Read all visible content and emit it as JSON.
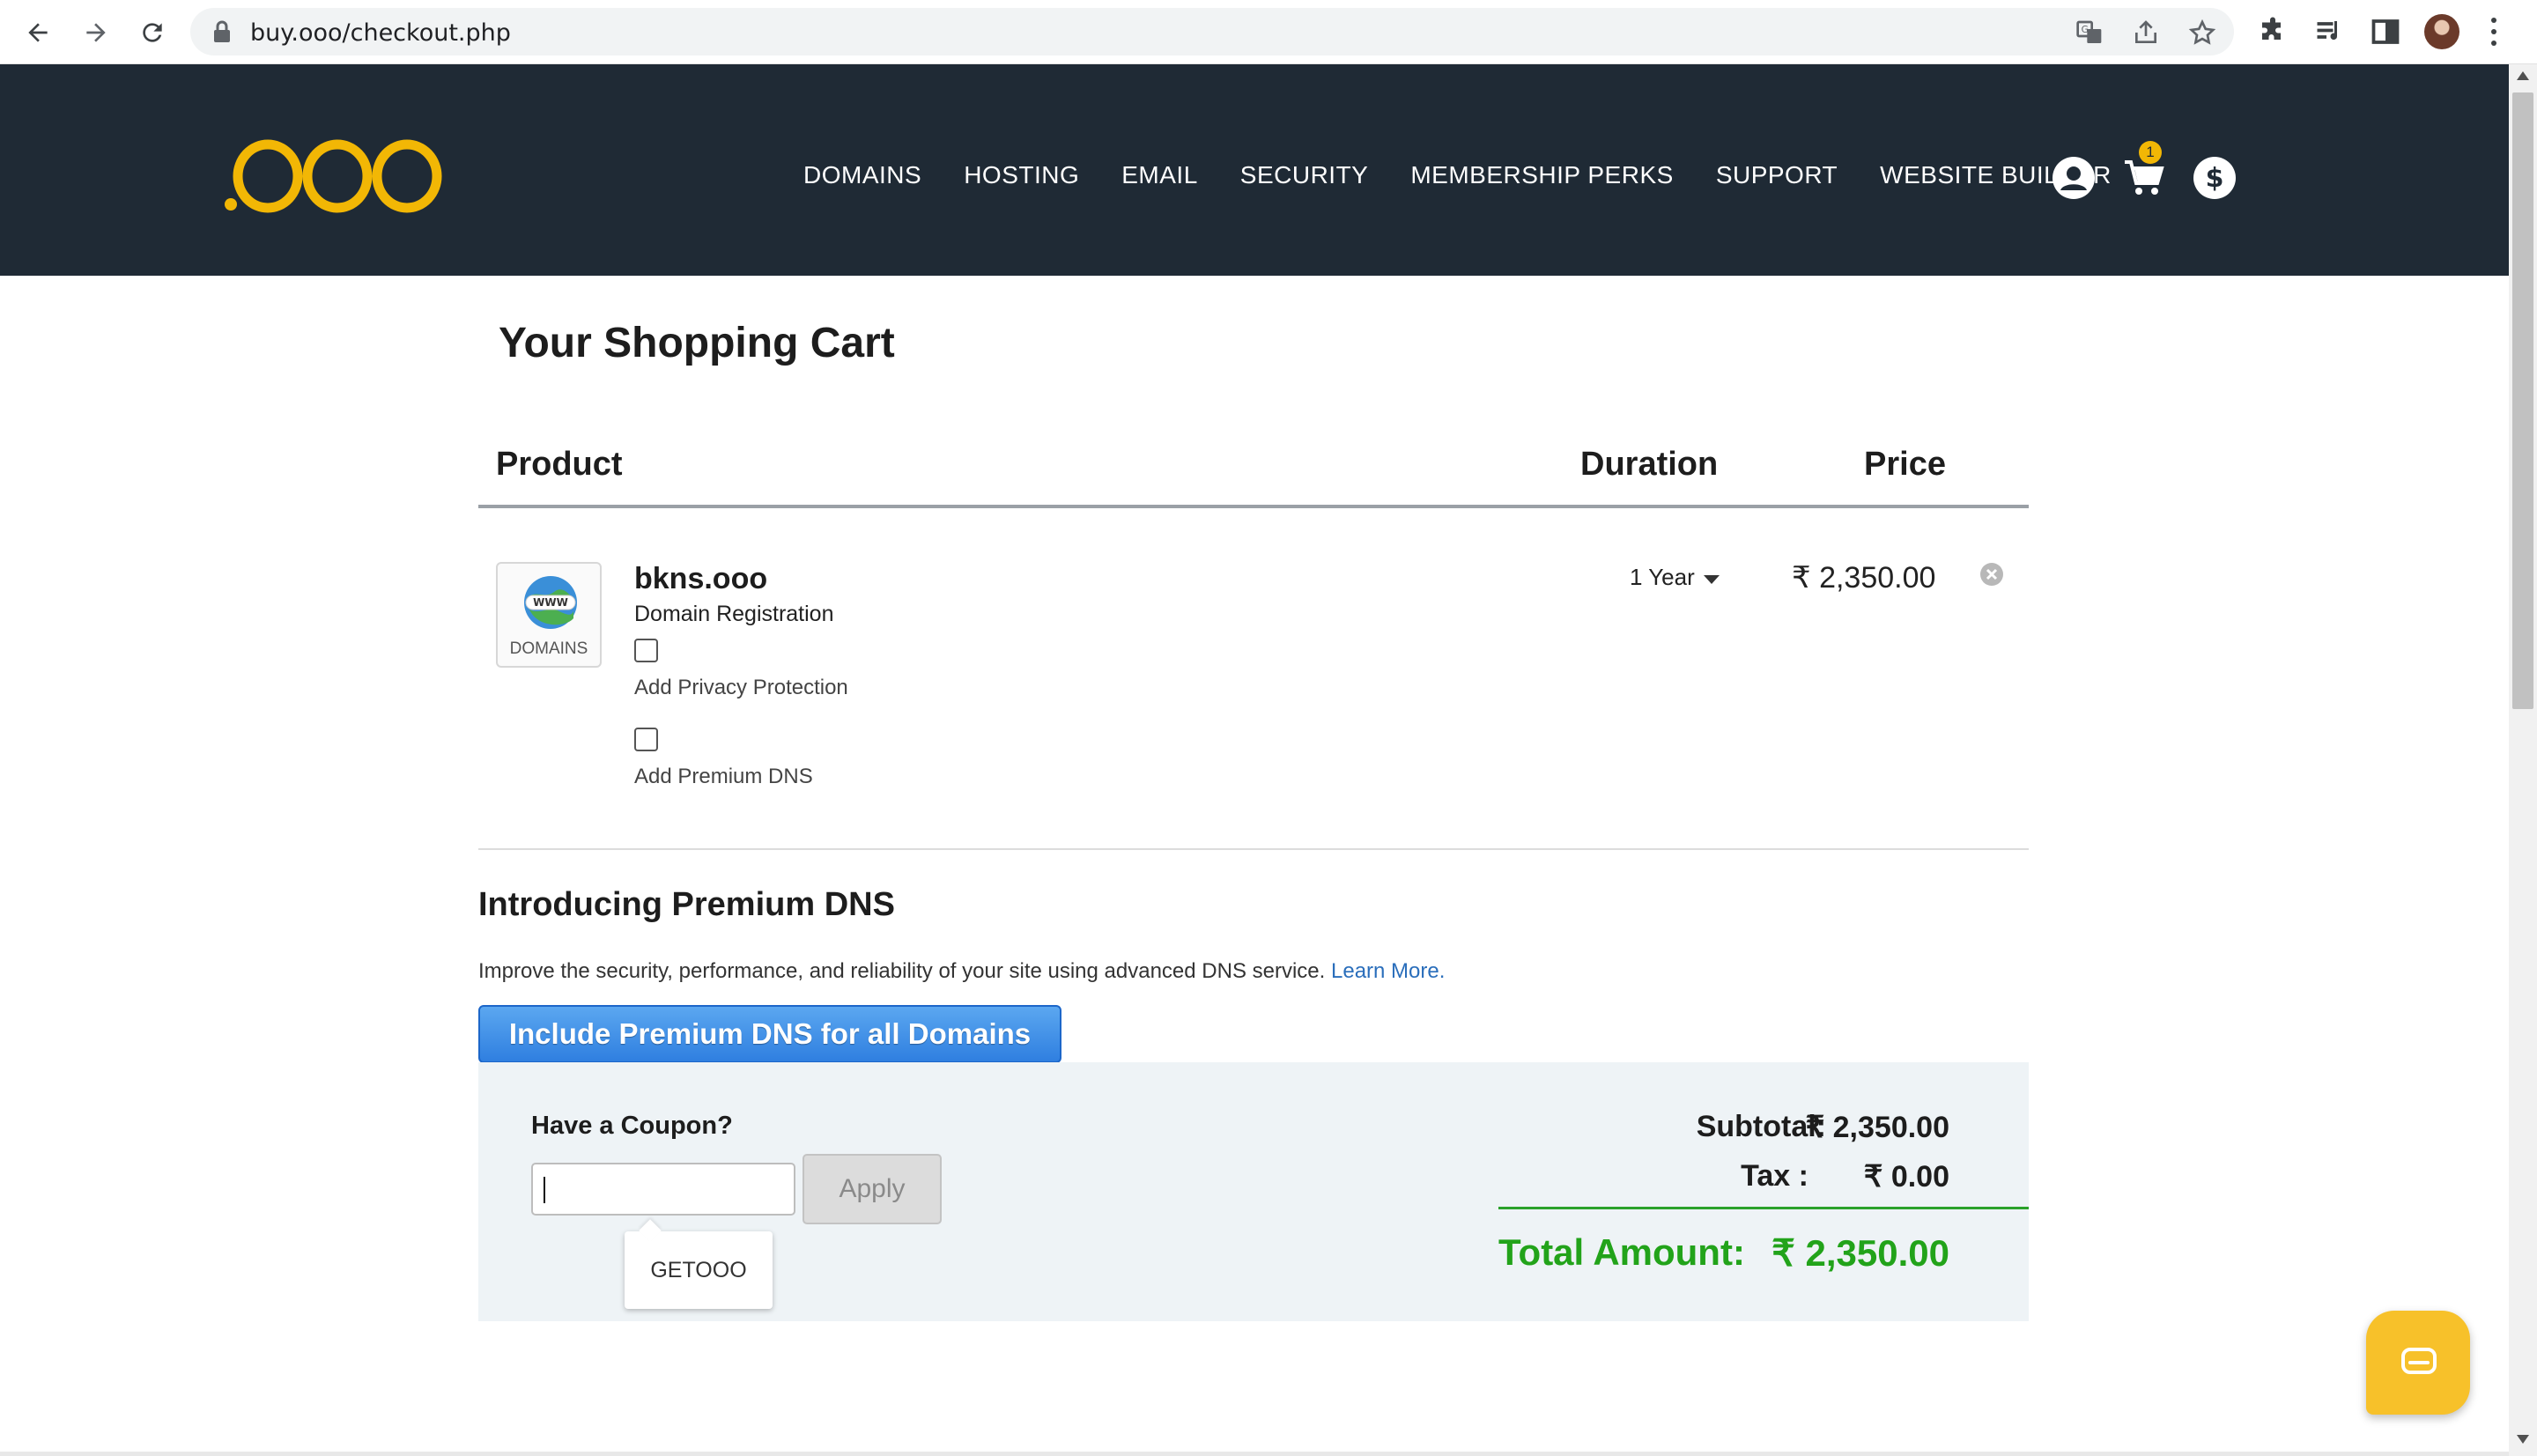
{
  "browser": {
    "url": "buy.ooo/checkout.php"
  },
  "header": {
    "logo_text": ".OOO",
    "nav": [
      "DOMAINS",
      "HOSTING",
      "EMAIL",
      "SECURITY",
      "MEMBERSHIP PERKS",
      "SUPPORT",
      "WEBSITE BUILDER"
    ],
    "cart_count": "1",
    "icons": [
      "account-icon",
      "cart-icon",
      "currency-icon"
    ]
  },
  "cart": {
    "title": "Your Shopping Cart",
    "columns": {
      "product": "Product",
      "duration": "Duration",
      "price": "Price"
    },
    "item": {
      "thumb_label": "DOMAINS",
      "globe_label": "WWW",
      "name": "bkns.ooo",
      "type": "Domain Registration",
      "addons": [
        "Add Privacy Protection",
        "Add Premium DNS"
      ],
      "duration": "1 Year",
      "price": "₹ 2,350.00"
    }
  },
  "premium_dns": {
    "heading": "Introducing Premium DNS",
    "description": "Improve the security, performance, and reliability of your site using advanced DNS service.",
    "learn_more": "Learn More.",
    "button": "Include Premium DNS for all Domains"
  },
  "summary": {
    "coupon_label": "Have a Coupon?",
    "coupon_value": "",
    "apply": "Apply",
    "suggestion": "GETOOO",
    "subtotal_label": "Subtotal:",
    "subtotal": "₹ 2,350.00",
    "tax_label": "Tax :",
    "tax": "₹ 0.00",
    "total_label": "Total Amount:",
    "total": "₹ 2,350.00"
  },
  "colors": {
    "header_bg": "#1f2a35",
    "logo": "#f2b705",
    "total_green": "#22a31a",
    "cta_blue": "#2f7fe0",
    "chat_yellow": "#f7c12a"
  }
}
